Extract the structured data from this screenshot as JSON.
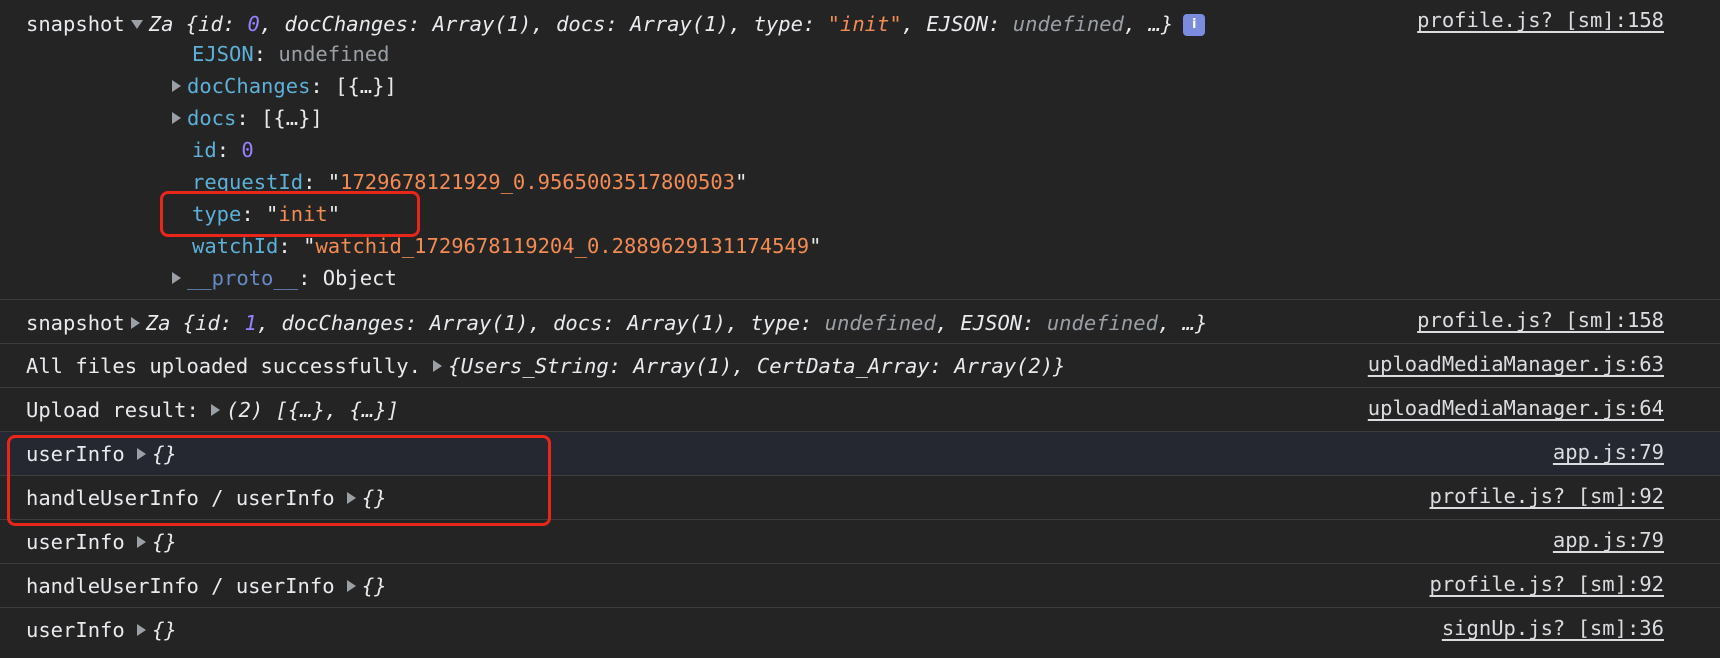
{
  "expanded": {
    "label": "snapshot",
    "summary": {
      "cls": "Za",
      "open": " {",
      "k_id": "id",
      "v_id": "0",
      "k_docChanges": "docChanges",
      "v_docChanges": "Array(1)",
      "k_docs": "docs",
      "v_docs": "Array(1)",
      "k_type": "type",
      "v_type": "\"init\"",
      "k_ejson": "EJSON",
      "v_ejson": "undefined",
      "tail": "…}"
    },
    "info_icon": "info-icon",
    "source": "profile.js? [sm]:158",
    "props": {
      "ejson_key": "EJSON",
      "ejson_val": "undefined",
      "docChanges_key": "docChanges",
      "docChanges_val": "[{…}]",
      "docs_key": "docs",
      "docs_val": "[{…}]",
      "id_key": "id",
      "id_val": "0",
      "requestId_key": "requestId",
      "requestId_val": "1729678121929_0.9565003517800503",
      "type_key": "type",
      "type_val": "init",
      "watchId_key": "watchId",
      "watchId_val": "watchid_1729678119204_0.2889629131174549",
      "proto_key": "__proto__",
      "proto_val": "Object"
    }
  },
  "rows": [
    {
      "label": "snapshot",
      "cls": "Za",
      "open": " {",
      "k_id": "id",
      "v_id": "1",
      "k_docChanges": "docChanges",
      "v_docChanges": "Array(1)",
      "k_docs": "docs",
      "v_docs": "Array(1)",
      "k_type": "type",
      "v_type": "undefined",
      "k_ejson": "EJSON",
      "v_ejson": "undefined",
      "tail": "…}",
      "source": "profile.js? [sm]:158"
    },
    {
      "label": "All files uploaded successfully.",
      "object": "{Users_String: Array(1), CertData_Array: Array(2)}",
      "source": "uploadMediaManager.js:63"
    },
    {
      "label": "Upload result:",
      "object": "(2) [{…}, {…}]",
      "source": "uploadMediaManager.js:64"
    },
    {
      "label": "userInfo",
      "object": "{}",
      "source": "app.js:79"
    },
    {
      "label": "handleUserInfo / userInfo",
      "object": "{}",
      "source": "profile.js? [sm]:92"
    },
    {
      "label": "userInfo",
      "object": "{}",
      "source": "app.js:79"
    },
    {
      "label": "handleUserInfo / userInfo",
      "object": "{}",
      "source": "profile.js? [sm]:92"
    },
    {
      "label": "userInfo",
      "object": "{}",
      "source": "signUp.js? [sm]:36"
    }
  ],
  "colors": {
    "background": "#242424",
    "key": "#5db0d7",
    "number": "#9980ff",
    "string": "#f28b54",
    "undefined": "#9aa0a6",
    "highlight_box": "#e8261a"
  }
}
